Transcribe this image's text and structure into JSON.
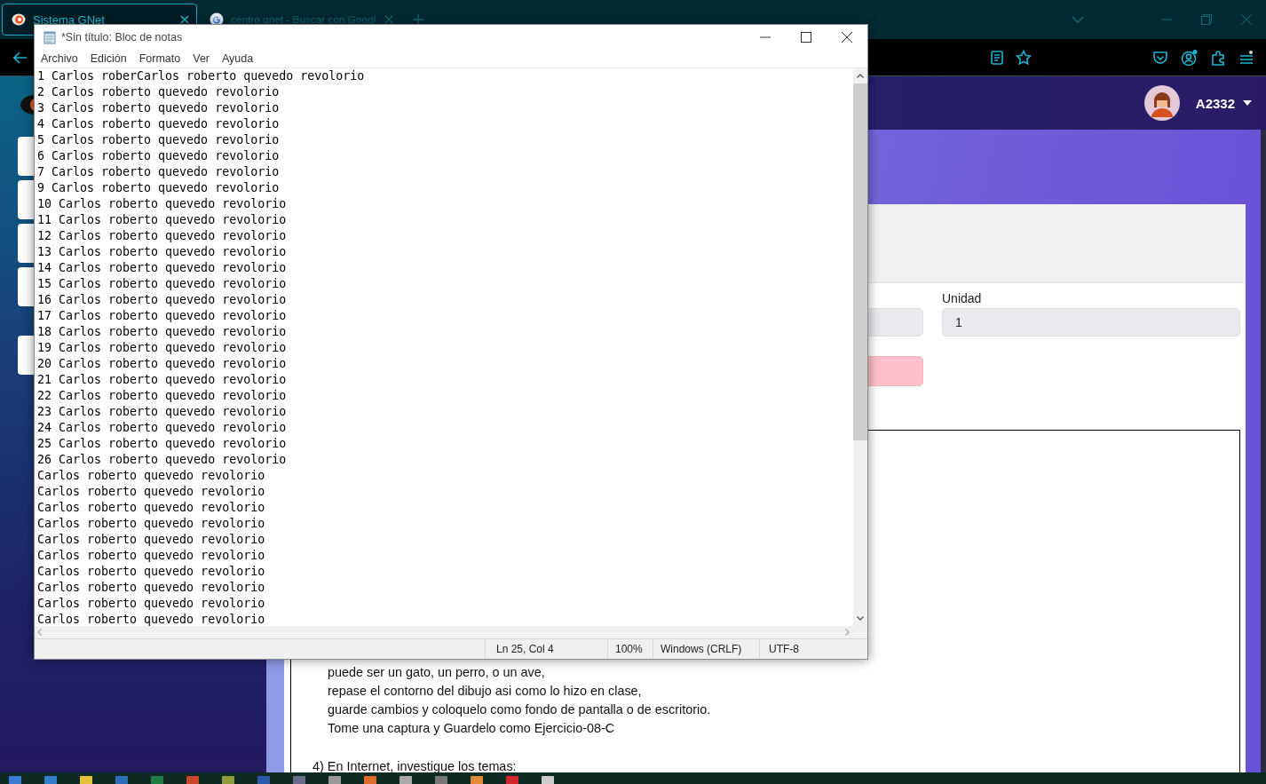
{
  "browser": {
    "tabs": [
      {
        "title": "Sistema GNet",
        "selected": true
      },
      {
        "title": "centro gnet - Buscar con Googl",
        "selected": false
      }
    ]
  },
  "page": {
    "user": "A2332",
    "fields": [
      {
        "label": "Unidad",
        "value": "1"
      }
    ],
    "instructions": [
      {
        "kind": "line",
        "text": "puede ser un gato, un perro, o un ave,"
      },
      {
        "kind": "line",
        "text": "repase el contorno del dibujo asi como lo hizo en clase,"
      },
      {
        "kind": "line",
        "text": "guarde cambios y coloquelo como fondo de pantalla o de escritorio."
      },
      {
        "kind": "line",
        "text": "Tome una captura y Guardelo como Ejercicio-08-C"
      },
      {
        "kind": "heading",
        "text": "4) En Internet, investigue los temas:"
      }
    ]
  },
  "notepad": {
    "title": "*Sin título: Bloc de notas",
    "menu": [
      "Archivo",
      "Edición",
      "Formato",
      "Ver",
      "Ayuda"
    ],
    "lines": [
      "1 Carlos roberCarlos roberto quevedo revolorio",
      "2 Carlos roberto quevedo revolorio",
      "3 Carlos roberto quevedo revolorio",
      "4 Carlos roberto quevedo revolorio",
      "5 Carlos roberto quevedo revolorio",
      "6 Carlos roberto quevedo revolorio",
      "7 Carlos roberto quevedo revolorio",
      "9 Carlos roberto quevedo revolorio",
      "10 Carlos roberto quevedo revolorio",
      "11 Carlos roberto quevedo revolorio",
      "12 Carlos roberto quevedo revolorio",
      "13 Carlos roberto quevedo revolorio",
      "14 Carlos roberto quevedo revolorio",
      "15 Carlos roberto quevedo revolorio",
      "16 Carlos roberto quevedo revolorio",
      "17 Carlos roberto quevedo revolorio",
      "18 Carlos roberto quevedo revolorio",
      "19 Carlos roberto quevedo revolorio",
      "20 Carlos roberto quevedo revolorio",
      "21 Carlos roberto quevedo revolorio",
      "22 Carlos roberto quevedo revolorio",
      "23 Carlos roberto quevedo revolorio",
      "24 Carlos roberto quevedo revolorio",
      "25 Carlos roberto quevedo revolorio",
      "26 Carlos roberto quevedo revolorio",
      "Carlos roberto quevedo revolorio",
      "Carlos roberto quevedo revolorio",
      "Carlos roberto quevedo revolorio",
      "Carlos roberto quevedo revolorio",
      "Carlos roberto quevedo revolorio",
      "Carlos roberto quevedo revolorio",
      "Carlos roberto quevedo revolorio",
      "Carlos roberto quevedo revolorio",
      "Carlos roberto quevedo revolorio",
      "Carlos roberto quevedo revolorio"
    ],
    "status": [
      "Ln 25, Col 4",
      "100%",
      "Windows (CRLF)",
      "UTF-8"
    ]
  }
}
